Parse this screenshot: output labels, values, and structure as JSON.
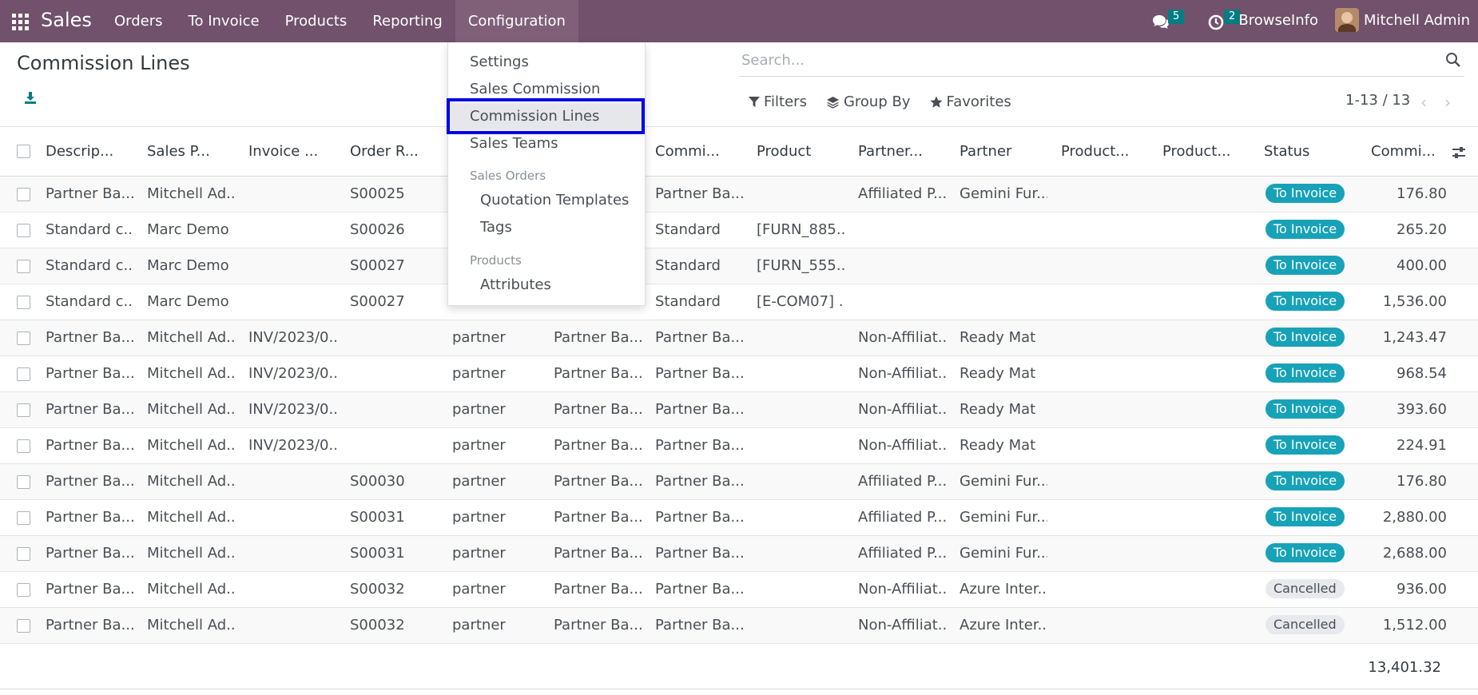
{
  "navbar": {
    "brand": "Sales",
    "menu": [
      "Orders",
      "To Invoice",
      "Products",
      "Reporting",
      "Configuration"
    ],
    "active_menu": "Configuration",
    "chat_count": "5",
    "activity_count": "2",
    "company": "BrowseInfo",
    "user": "Mitchell Admin",
    "icons": [
      "apps-grid-icon",
      "chat-icon",
      "clock-icon",
      "avatar"
    ]
  },
  "control_panel": {
    "title": "Commission Lines",
    "search_placeholder": "Search...",
    "filters_label": "Filters",
    "groupby_label": "Group By",
    "favorites_label": "Favorites",
    "pager": "1-13 / 13"
  },
  "dropdown": {
    "items": [
      "Settings",
      "Sales Commission",
      "Commission Lines",
      "Sales Teams"
    ],
    "section_sales_orders": "Sales Orders",
    "sales_orders_items": [
      "Quotation Templates",
      "Tags"
    ],
    "section_products": "Products",
    "products_items": [
      "Attributes"
    ],
    "highlighted": "Commission Lines"
  },
  "table": {
    "headers": [
      "Descrip...",
      "Sales P...",
      "Invoice ...",
      "Order R...",
      "",
      "",
      "Commi...",
      "Product",
      "Partner...",
      "Partner",
      "Product...",
      "Product...",
      "Status",
      "Commi..."
    ],
    "rows": [
      [
        "Partner Ba...",
        "Mitchell Ad...",
        "",
        "S00025",
        "",
        "",
        "Partner Ba...",
        "",
        "Affiliated P...",
        "Gemini Fur...",
        "",
        "",
        "To Invoice",
        "176.80"
      ],
      [
        "Standard c...",
        "Marc Demo",
        "",
        "S00026",
        "",
        "",
        "Standard",
        "[FURN_885...",
        "",
        "",
        "",
        "",
        "To Invoice",
        "265.20"
      ],
      [
        "Standard c...",
        "Marc Demo",
        "",
        "S00027",
        "",
        "",
        "Standard",
        "[FURN_555...",
        "",
        "",
        "",
        "",
        "To Invoice",
        "400.00"
      ],
      [
        "Standard c...",
        "Marc Demo",
        "",
        "S00027",
        "",
        "",
        "Standard",
        "[E-COM07] ...",
        "",
        "",
        "",
        "",
        "To Invoice",
        "1,536.00"
      ],
      [
        "Partner Ba...",
        "Mitchell Ad...",
        "INV/2023/0...",
        "",
        "partner",
        "Partner Ba...",
        "Partner Ba...",
        "",
        "Non-Affiliat...",
        "Ready Mat",
        "",
        "",
        "To Invoice",
        "1,243.47"
      ],
      [
        "Partner Ba...",
        "Mitchell Ad...",
        "INV/2023/0...",
        "",
        "partner",
        "Partner Ba...",
        "Partner Ba...",
        "",
        "Non-Affiliat...",
        "Ready Mat",
        "",
        "",
        "To Invoice",
        "968.54"
      ],
      [
        "Partner Ba...",
        "Mitchell Ad...",
        "INV/2023/0...",
        "",
        "partner",
        "Partner Ba...",
        "Partner Ba...",
        "",
        "Non-Affiliat...",
        "Ready Mat",
        "",
        "",
        "To Invoice",
        "393.60"
      ],
      [
        "Partner Ba...",
        "Mitchell Ad...",
        "INV/2023/0...",
        "",
        "partner",
        "Partner Ba...",
        "Partner Ba...",
        "",
        "Non-Affiliat...",
        "Ready Mat",
        "",
        "",
        "To Invoice",
        "224.91"
      ],
      [
        "Partner Ba...",
        "Mitchell Ad...",
        "",
        "S00030",
        "partner",
        "Partner Ba...",
        "Partner Ba...",
        "",
        "Affiliated P...",
        "Gemini Fur...",
        "",
        "",
        "To Invoice",
        "176.80"
      ],
      [
        "Partner Ba...",
        "Mitchell Ad...",
        "",
        "S00031",
        "partner",
        "Partner Ba...",
        "Partner Ba...",
        "",
        "Affiliated P...",
        "Gemini Fur...",
        "",
        "",
        "To Invoice",
        "2,880.00"
      ],
      [
        "Partner Ba...",
        "Mitchell Ad...",
        "",
        "S00031",
        "partner",
        "Partner Ba...",
        "Partner Ba...",
        "",
        "Affiliated P...",
        "Gemini Fur...",
        "",
        "",
        "To Invoice",
        "2,688.00"
      ],
      [
        "Partner Ba...",
        "Mitchell Ad...",
        "",
        "S00032",
        "partner",
        "Partner Ba...",
        "Partner Ba...",
        "",
        "Non-Affiliat...",
        "Azure Inter...",
        "",
        "",
        "Cancelled",
        "936.00"
      ],
      [
        "Partner Ba...",
        "Mitchell Ad...",
        "",
        "S00032",
        "partner",
        "Partner Ba...",
        "Partner Ba...",
        "",
        "Non-Affiliat...",
        "Azure Inter...",
        "",
        "",
        "Cancelled",
        "1,512.00"
      ]
    ],
    "total": "13,401.32"
  },
  "colors": {
    "navbar": "#71516c",
    "pill_invoice": "#17a2b8",
    "pill_cancel": "#e7e9ed",
    "highlight": "#0000e6"
  }
}
